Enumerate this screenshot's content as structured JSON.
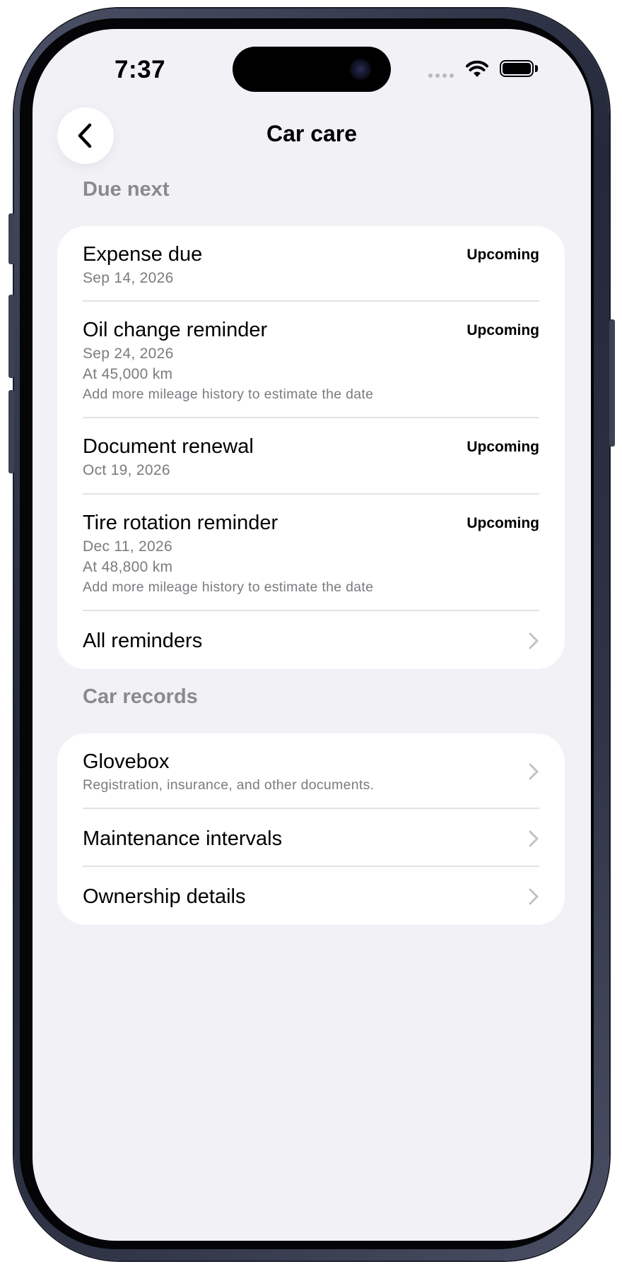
{
  "status_bar": {
    "time": "7:37"
  },
  "header": {
    "title": "Car care",
    "back_icon": "chevron-left-icon"
  },
  "due_next": {
    "label": "Due next",
    "items": [
      {
        "title": "Expense due",
        "status": "Upcoming",
        "lines": [
          "Sep 14, 2026"
        ]
      },
      {
        "title": "Oil change reminder",
        "status": "Upcoming",
        "lines": [
          "Sep 24, 2026",
          "At 45,000 km",
          "Add more mileage history to estimate the date"
        ]
      },
      {
        "title": "Document renewal",
        "status": "Upcoming",
        "lines": [
          "Oct 19, 2026"
        ]
      },
      {
        "title": "Tire rotation reminder",
        "status": "Upcoming",
        "lines": [
          "Dec 11, 2026",
          "At 48,800 km",
          "Add more mileage history to estimate the date"
        ]
      }
    ],
    "all_label": "All reminders"
  },
  "car_records": {
    "label": "Car records",
    "items": [
      {
        "title": "Glovebox",
        "subtitle": "Registration, insurance, and other documents."
      },
      {
        "title": "Maintenance intervals"
      },
      {
        "title": "Ownership details"
      }
    ]
  },
  "colors": {
    "background": "#f1f1f6",
    "card": "#ffffff",
    "secondary_text": "#7b7b80",
    "section_label": "#8a8a8e",
    "divider": "#e3e3e7",
    "chevron": "#c2c2c6"
  }
}
